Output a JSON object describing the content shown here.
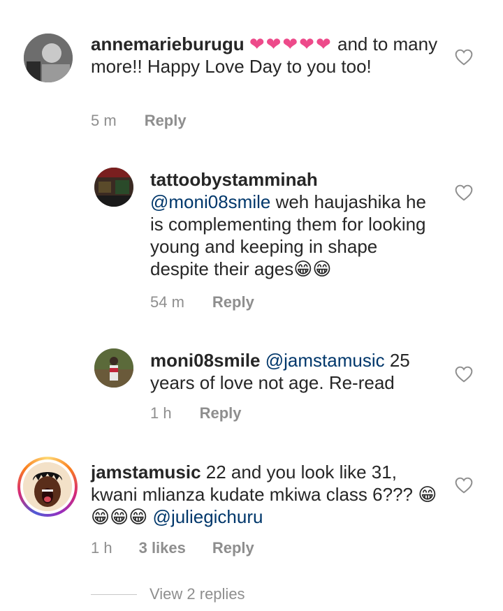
{
  "comments": [
    {
      "username": "annemarieburugu",
      "hearts": "❤❤❤❤❤",
      "text_after_hearts": " and to many more!! Happy Love Day to you too!",
      "time": "5 m",
      "reply": "Reply"
    },
    {
      "username": "tattoobystamminah",
      "mention": "@moni08smile",
      "text": " weh haujashika he is complementing them for looking young and keeping in shape despite their ages😁😁",
      "time": "54 m",
      "reply": "Reply"
    },
    {
      "username": "moni08smile",
      "mention": "@jamstamusic",
      "text": " 25 years of love not age. Re-read",
      "time": "1 h",
      "reply": "Reply"
    },
    {
      "username": "jamstamusic",
      "text": " 22 and you look like 31, kwani mlianza kudate mkiwa class 6??? 😁😁😁😁 ",
      "mention": "@juliegichuru",
      "time": "1 h",
      "likes": "3 likes",
      "reply": "Reply"
    }
  ],
  "view_replies": "View 2 replies",
  "colors": {
    "text": "#262626",
    "meta": "#8e8e8e",
    "mention": "#00376b",
    "heart_emoji": "#ed4a8a"
  },
  "icons": {
    "like": "heart-outline-icon"
  }
}
